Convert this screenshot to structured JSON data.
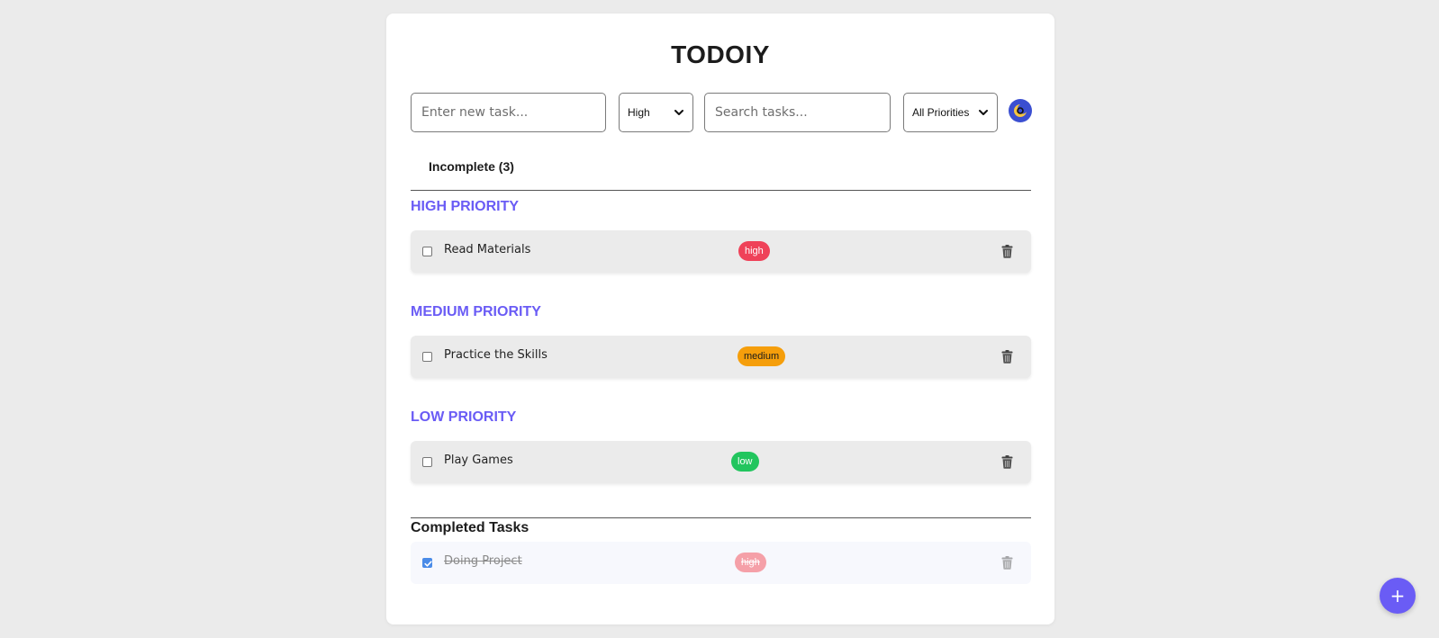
{
  "app": {
    "title": "TODOIY"
  },
  "controls": {
    "task_placeholder": "Enter new task...",
    "priority_selected": "High",
    "search_placeholder": "Search tasks...",
    "filter_selected": "All Priorities",
    "theme_icon": "theme-toggle-icon"
  },
  "tabs": {
    "incomplete_label": "Incomplete (3)"
  },
  "sections": [
    {
      "heading": "HIGH PRIORITY",
      "tasks": [
        {
          "text": "Read Materials",
          "priority": "high",
          "completed": false
        }
      ]
    },
    {
      "heading": "MEDIUM PRIORITY",
      "tasks": [
        {
          "text": "Practice the Skills",
          "priority": "medium",
          "completed": false
        }
      ]
    },
    {
      "heading": "LOW PRIORITY",
      "tasks": [
        {
          "text": "Play Games",
          "priority": "low",
          "completed": false
        }
      ]
    }
  ],
  "completed": {
    "heading": "Completed Tasks",
    "tasks": [
      {
        "text": "Doing Project",
        "priority": "high",
        "completed": true
      }
    ]
  },
  "fab": {
    "label": "+"
  },
  "colors": {
    "accent": "#6a5cf5",
    "high": "#ef4259",
    "medium": "#f59e0b",
    "low": "#22c55e"
  }
}
